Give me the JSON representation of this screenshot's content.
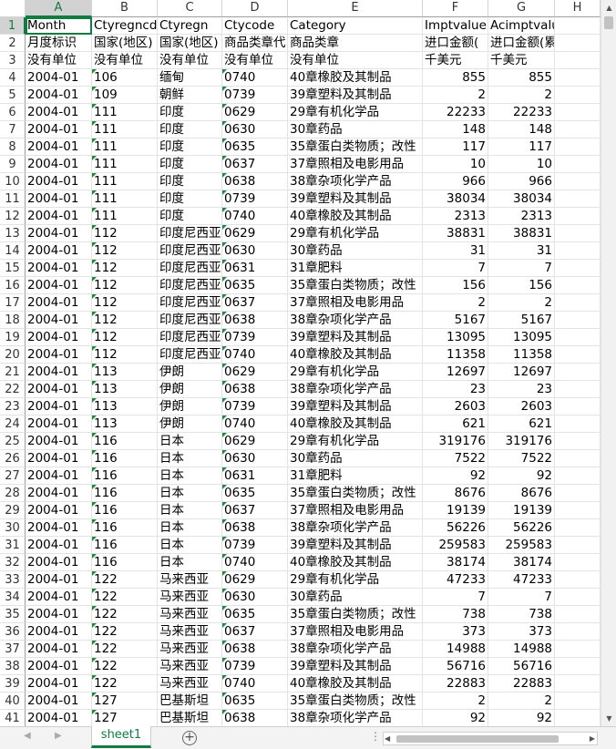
{
  "columns": [
    "A",
    "B",
    "C",
    "D",
    "E",
    "F",
    "G",
    "H"
  ],
  "active_column": "A",
  "active_row": 1,
  "rows": [
    {
      "n": "1",
      "c": [
        "Month",
        "Ctyregncd",
        "Ctyregn",
        "Ctycode",
        "Category",
        "Imptvalue",
        "Acimptvalue",
        ""
      ]
    },
    {
      "n": "2",
      "c": [
        "月度标识",
        "国家(地区)",
        "国家(地区)",
        "商品类章代",
        "商品类章",
        "进口金额(",
        "进口金额(累计)",
        ""
      ]
    },
    {
      "n": "3",
      "c": [
        "没有单位",
        "没有单位",
        "没有单位",
        "没有单位",
        "没有单位",
        "千美元",
        "千美元",
        ""
      ]
    },
    {
      "n": "4",
      "c": [
        "2004-01",
        "106",
        "缅甸",
        "0740",
        "40章橡胶及其制品",
        "855",
        "855",
        ""
      ]
    },
    {
      "n": "5",
      "c": [
        "2004-01",
        "109",
        "朝鲜",
        "0739",
        "39章塑料及其制品",
        "2",
        "2",
        ""
      ]
    },
    {
      "n": "6",
      "c": [
        "2004-01",
        "111",
        "印度",
        "0629",
        "29章有机化学品",
        "22233",
        "22233",
        ""
      ]
    },
    {
      "n": "7",
      "c": [
        "2004-01",
        "111",
        "印度",
        "0630",
        "30章药品",
        "148",
        "148",
        ""
      ]
    },
    {
      "n": "8",
      "c": [
        "2004-01",
        "111",
        "印度",
        "0635",
        "35章蛋白类物质；改性",
        "117",
        "117",
        ""
      ]
    },
    {
      "n": "9",
      "c": [
        "2004-01",
        "111",
        "印度",
        "0637",
        "37章照相及电影用品",
        "10",
        "10",
        ""
      ]
    },
    {
      "n": "10",
      "c": [
        "2004-01",
        "111",
        "印度",
        "0638",
        "38章杂项化学产品",
        "966",
        "966",
        ""
      ]
    },
    {
      "n": "11",
      "c": [
        "2004-01",
        "111",
        "印度",
        "0739",
        "39章塑料及其制品",
        "38034",
        "38034",
        ""
      ]
    },
    {
      "n": "12",
      "c": [
        "2004-01",
        "111",
        "印度",
        "0740",
        "40章橡胶及其制品",
        "2313",
        "2313",
        ""
      ]
    },
    {
      "n": "13",
      "c": [
        "2004-01",
        "112",
        "印度尼西亚",
        "0629",
        "29章有机化学品",
        "38831",
        "38831",
        ""
      ]
    },
    {
      "n": "14",
      "c": [
        "2004-01",
        "112",
        "印度尼西亚",
        "0630",
        "30章药品",
        "31",
        "31",
        ""
      ]
    },
    {
      "n": "15",
      "c": [
        "2004-01",
        "112",
        "印度尼西亚",
        "0631",
        "31章肥料",
        "7",
        "7",
        ""
      ]
    },
    {
      "n": "16",
      "c": [
        "2004-01",
        "112",
        "印度尼西亚",
        "0635",
        "35章蛋白类物质；改性",
        "156",
        "156",
        ""
      ]
    },
    {
      "n": "17",
      "c": [
        "2004-01",
        "112",
        "印度尼西亚",
        "0637",
        "37章照相及电影用品",
        "2",
        "2",
        ""
      ]
    },
    {
      "n": "18",
      "c": [
        "2004-01",
        "112",
        "印度尼西亚",
        "0638",
        "38章杂项化学产品",
        "5167",
        "5167",
        ""
      ]
    },
    {
      "n": "19",
      "c": [
        "2004-01",
        "112",
        "印度尼西亚",
        "0739",
        "39章塑料及其制品",
        "13095",
        "13095",
        ""
      ]
    },
    {
      "n": "20",
      "c": [
        "2004-01",
        "112",
        "印度尼西亚",
        "0740",
        "40章橡胶及其制品",
        "11358",
        "11358",
        ""
      ]
    },
    {
      "n": "21",
      "c": [
        "2004-01",
        "113",
        "伊朗",
        "0629",
        "29章有机化学品",
        "12697",
        "12697",
        ""
      ]
    },
    {
      "n": "22",
      "c": [
        "2004-01",
        "113",
        "伊朗",
        "0638",
        "38章杂项化学产品",
        "23",
        "23",
        ""
      ]
    },
    {
      "n": "23",
      "c": [
        "2004-01",
        "113",
        "伊朗",
        "0739",
        "39章塑料及其制品",
        "2603",
        "2603",
        ""
      ]
    },
    {
      "n": "24",
      "c": [
        "2004-01",
        "113",
        "伊朗",
        "0740",
        "40章橡胶及其制品",
        "621",
        "621",
        ""
      ]
    },
    {
      "n": "25",
      "c": [
        "2004-01",
        "116",
        "日本",
        "0629",
        "29章有机化学品",
        "319176",
        "319176",
        ""
      ]
    },
    {
      "n": "26",
      "c": [
        "2004-01",
        "116",
        "日本",
        "0630",
        "30章药品",
        "7522",
        "7522",
        ""
      ]
    },
    {
      "n": "27",
      "c": [
        "2004-01",
        "116",
        "日本",
        "0631",
        "31章肥料",
        "92",
        "92",
        ""
      ]
    },
    {
      "n": "28",
      "c": [
        "2004-01",
        "116",
        "日本",
        "0635",
        "35章蛋白类物质；改性",
        "8676",
        "8676",
        ""
      ]
    },
    {
      "n": "29",
      "c": [
        "2004-01",
        "116",
        "日本",
        "0637",
        "37章照相及电影用品",
        "19139",
        "19139",
        ""
      ]
    },
    {
      "n": "30",
      "c": [
        "2004-01",
        "116",
        "日本",
        "0638",
        "38章杂项化学产品",
        "56226",
        "56226",
        ""
      ]
    },
    {
      "n": "31",
      "c": [
        "2004-01",
        "116",
        "日本",
        "0739",
        "39章塑料及其制品",
        "259583",
        "259583",
        ""
      ]
    },
    {
      "n": "32",
      "c": [
        "2004-01",
        "116",
        "日本",
        "0740",
        "40章橡胶及其制品",
        "38174",
        "38174",
        ""
      ]
    },
    {
      "n": "33",
      "c": [
        "2004-01",
        "122",
        "马来西亚",
        "0629",
        "29章有机化学品",
        "47233",
        "47233",
        ""
      ]
    },
    {
      "n": "34",
      "c": [
        "2004-01",
        "122",
        "马来西亚",
        "0630",
        "30章药品",
        "7",
        "7",
        ""
      ]
    },
    {
      "n": "35",
      "c": [
        "2004-01",
        "122",
        "马来西亚",
        "0635",
        "35章蛋白类物质；改性",
        "738",
        "738",
        ""
      ]
    },
    {
      "n": "36",
      "c": [
        "2004-01",
        "122",
        "马来西亚",
        "0637",
        "37章照相及电影用品",
        "373",
        "373",
        ""
      ]
    },
    {
      "n": "37",
      "c": [
        "2004-01",
        "122",
        "马来西亚",
        "0638",
        "38章杂项化学产品",
        "14988",
        "14988",
        ""
      ]
    },
    {
      "n": "38",
      "c": [
        "2004-01",
        "122",
        "马来西亚",
        "0739",
        "39章塑料及其制品",
        "56716",
        "56716",
        ""
      ]
    },
    {
      "n": "39",
      "c": [
        "2004-01",
        "122",
        "马来西亚",
        "0740",
        "40章橡胶及其制品",
        "22883",
        "22883",
        ""
      ]
    },
    {
      "n": "40",
      "c": [
        "2004-01",
        "127",
        "巴基斯坦",
        "0635",
        "35章蛋白类物质；改性",
        "2",
        "2",
        ""
      ]
    },
    {
      "n": "41",
      "c": [
        "2004-01",
        "127",
        "巴基斯坦",
        "0638",
        "38章杂项化学产品",
        "92",
        "92",
        ""
      ]
    }
  ],
  "sheet_tab": "sheet1",
  "add_sheet_symbol": "+",
  "nav_prev": "◀",
  "nav_next": "▶",
  "dots": "⋮",
  "scroll_up": "▲",
  "scroll_down": "▼",
  "scroll_left": "◀",
  "scroll_right": "▶",
  "colors": {
    "accent": "#107c41",
    "flag": "#1e8a3e"
  }
}
